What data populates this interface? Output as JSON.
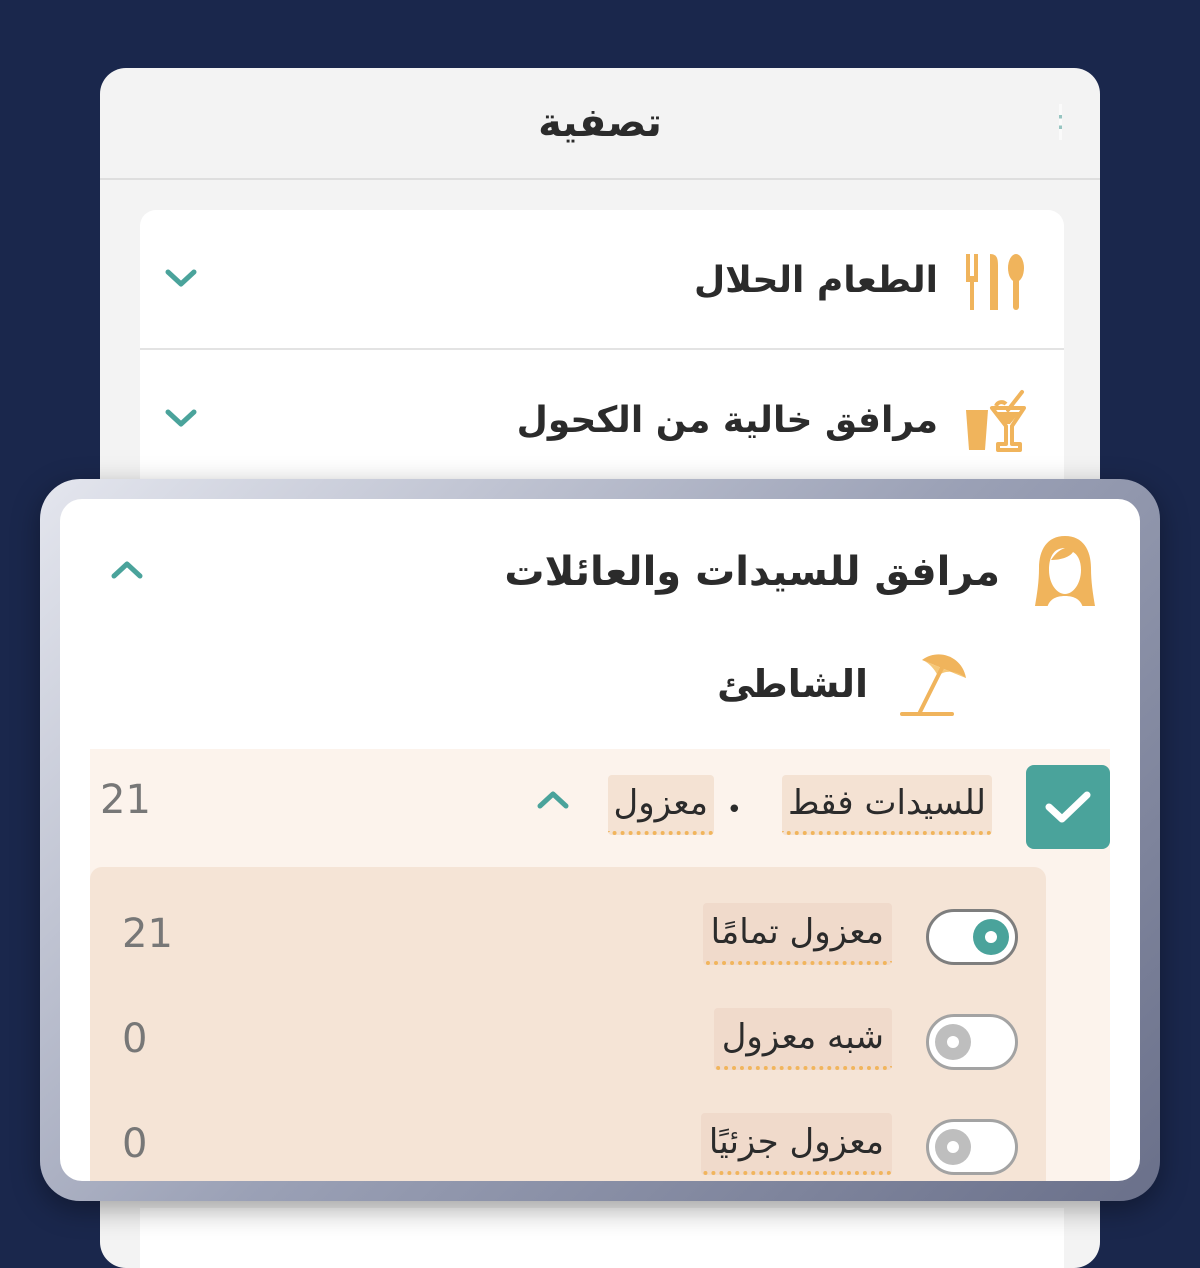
{
  "header": {
    "title": "تصفية"
  },
  "categories": [
    {
      "label": "الطعام الحلال",
      "icon": "cutlery-icon",
      "expanded": false
    },
    {
      "label": "مرافق خالية من الكحول",
      "icon": "mocktail-icon",
      "expanded": false
    },
    {
      "label": "مرافق للسيدات والعائلات",
      "icon": "woman-icon",
      "expanded": true
    }
  ],
  "women_facilities": {
    "subcategory": {
      "label": "الشاطئ",
      "icon": "beach-umbrella-icon"
    },
    "option": {
      "checked": true,
      "tags": [
        "للسيدات فقط",
        "معزول"
      ],
      "separator": "•",
      "count": "21",
      "expanded": true
    },
    "levels": [
      {
        "label": "معزول تمامًا",
        "selected": true,
        "count": "21"
      },
      {
        "label": "شبه معزول",
        "selected": false,
        "count": "0"
      },
      {
        "label": "معزول جزئيًا",
        "selected": false,
        "count": "0"
      }
    ]
  },
  "colors": {
    "background": "#1a274c",
    "accent_teal": "#4aa39b",
    "icon_orange": "#f0b45c",
    "option_bg": "#fcf3ec",
    "levels_bg": "#f5e4d6"
  }
}
